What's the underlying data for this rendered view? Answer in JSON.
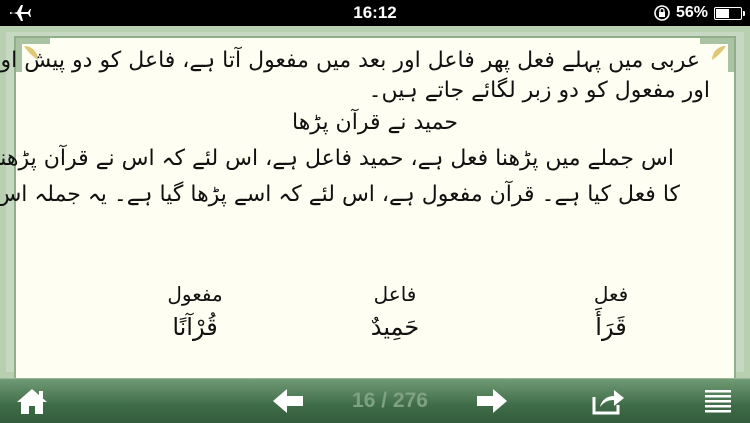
{
  "status_bar": {
    "time": "16:12",
    "battery_percent_text": "56%",
    "battery_level": 0.56,
    "icons": [
      "airplane-icon",
      "rotation-lock-icon",
      "battery-icon"
    ]
  },
  "page": {
    "header_tag": "",
    "lines": [
      "عربی میں پہلے فعل پھر فاعل اور بعد میں مفعول آتا ہے، فاعل کو دو پیش اور",
      "اور مفعول کو دو زبر لگائے جاتے ہیں۔",
      "حمید نے قرآن پڑھا",
      "اس جملے میں پڑھنا فعل ہے، حمید فاعل ہے، اس لئے کہ اس نے قرآن پڑھنے",
      "کا فعل کیا ہے۔ قرآن مفعول ہے، اس لئے کہ اسے پڑھا گیا ہے۔ یہ جملہ اس طرح ہوگا۔"
    ],
    "table": {
      "headers": [
        "فعل",
        "فاعل",
        "مفعول"
      ],
      "words": [
        "قَرَأَ",
        "حَمِيدٌ",
        "قُرْآنًا"
      ]
    }
  },
  "toolbar": {
    "page_indicator": "16 / 276",
    "icons": [
      "home-icon",
      "back-arrow-icon",
      "forward-arrow-icon",
      "share-icon",
      "menu-icon"
    ]
  },
  "colors": {
    "page_bg": "#fffef2",
    "frame": "#c7d8c2",
    "toolbar": "#3f6c48",
    "indicator": "#7fa183"
  }
}
